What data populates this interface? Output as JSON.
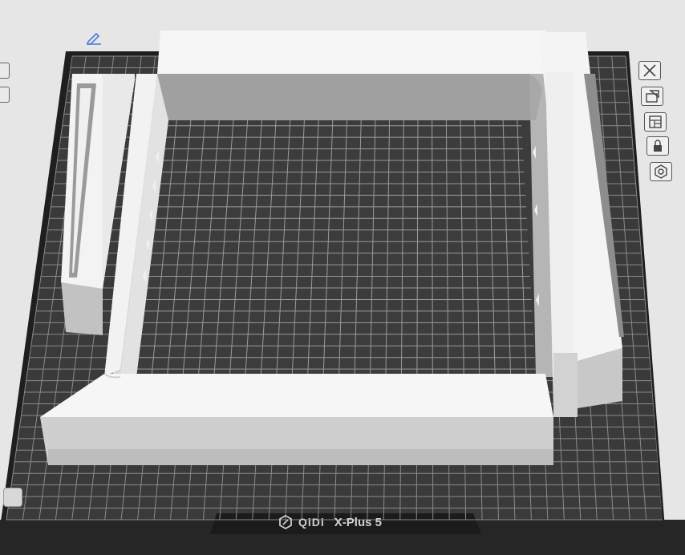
{
  "plate": {
    "brand_logo": "QiDi",
    "printer_model": "X-Plus 5"
  },
  "toolbar": {
    "icons": [
      "close-icon",
      "auto-orient-icon",
      "arrange-icon",
      "lock-icon",
      "settings-icon"
    ]
  },
  "colors": {
    "background": "#e6e6e6",
    "plate_dark": "#2e2e2e",
    "grid_line": "#8a8a8a",
    "model_white": "#f4f4f4",
    "model_shadow": "#bdbdbd",
    "accent": "#4a7bd8"
  }
}
